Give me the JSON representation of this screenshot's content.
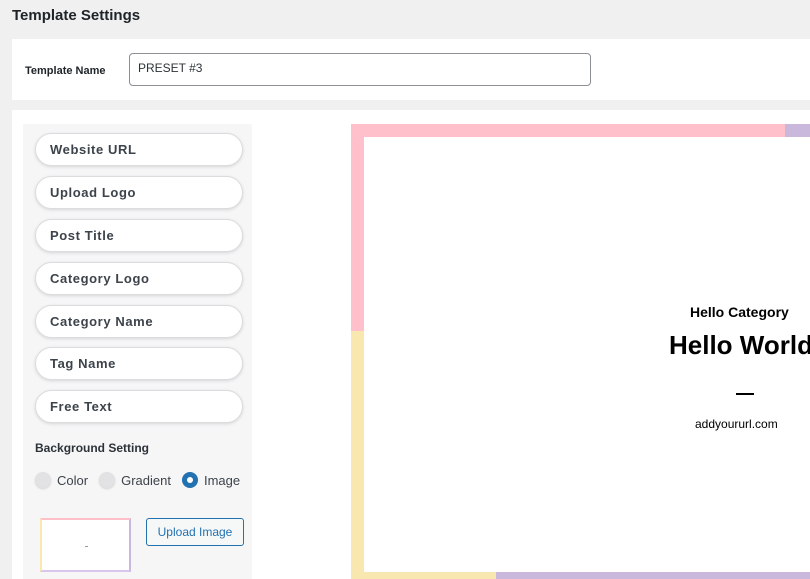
{
  "page": {
    "title": "Template Settings"
  },
  "template_name": {
    "label": "Template Name",
    "value": "PRESET #3"
  },
  "elements": {
    "items": [
      {
        "label": "Website URL"
      },
      {
        "label": "Upload Logo"
      },
      {
        "label": "Post Title"
      },
      {
        "label": "Category Logo"
      },
      {
        "label": "Category Name"
      },
      {
        "label": "Tag Name"
      },
      {
        "label": "Free Text"
      }
    ]
  },
  "background": {
    "heading": "Background Setting",
    "options": [
      {
        "label": "Color",
        "checked": false
      },
      {
        "label": "Gradient",
        "checked": false
      },
      {
        "label": "Image",
        "checked": true
      }
    ],
    "upload_label": "Upload Image"
  },
  "preview": {
    "category": "Hello Category",
    "title": "Hello World",
    "url": "addyoururl.com",
    "colors": {
      "pink": "#ffc0cb",
      "purple": "#c9b8dc",
      "yellow": "#f8e8b0"
    }
  }
}
